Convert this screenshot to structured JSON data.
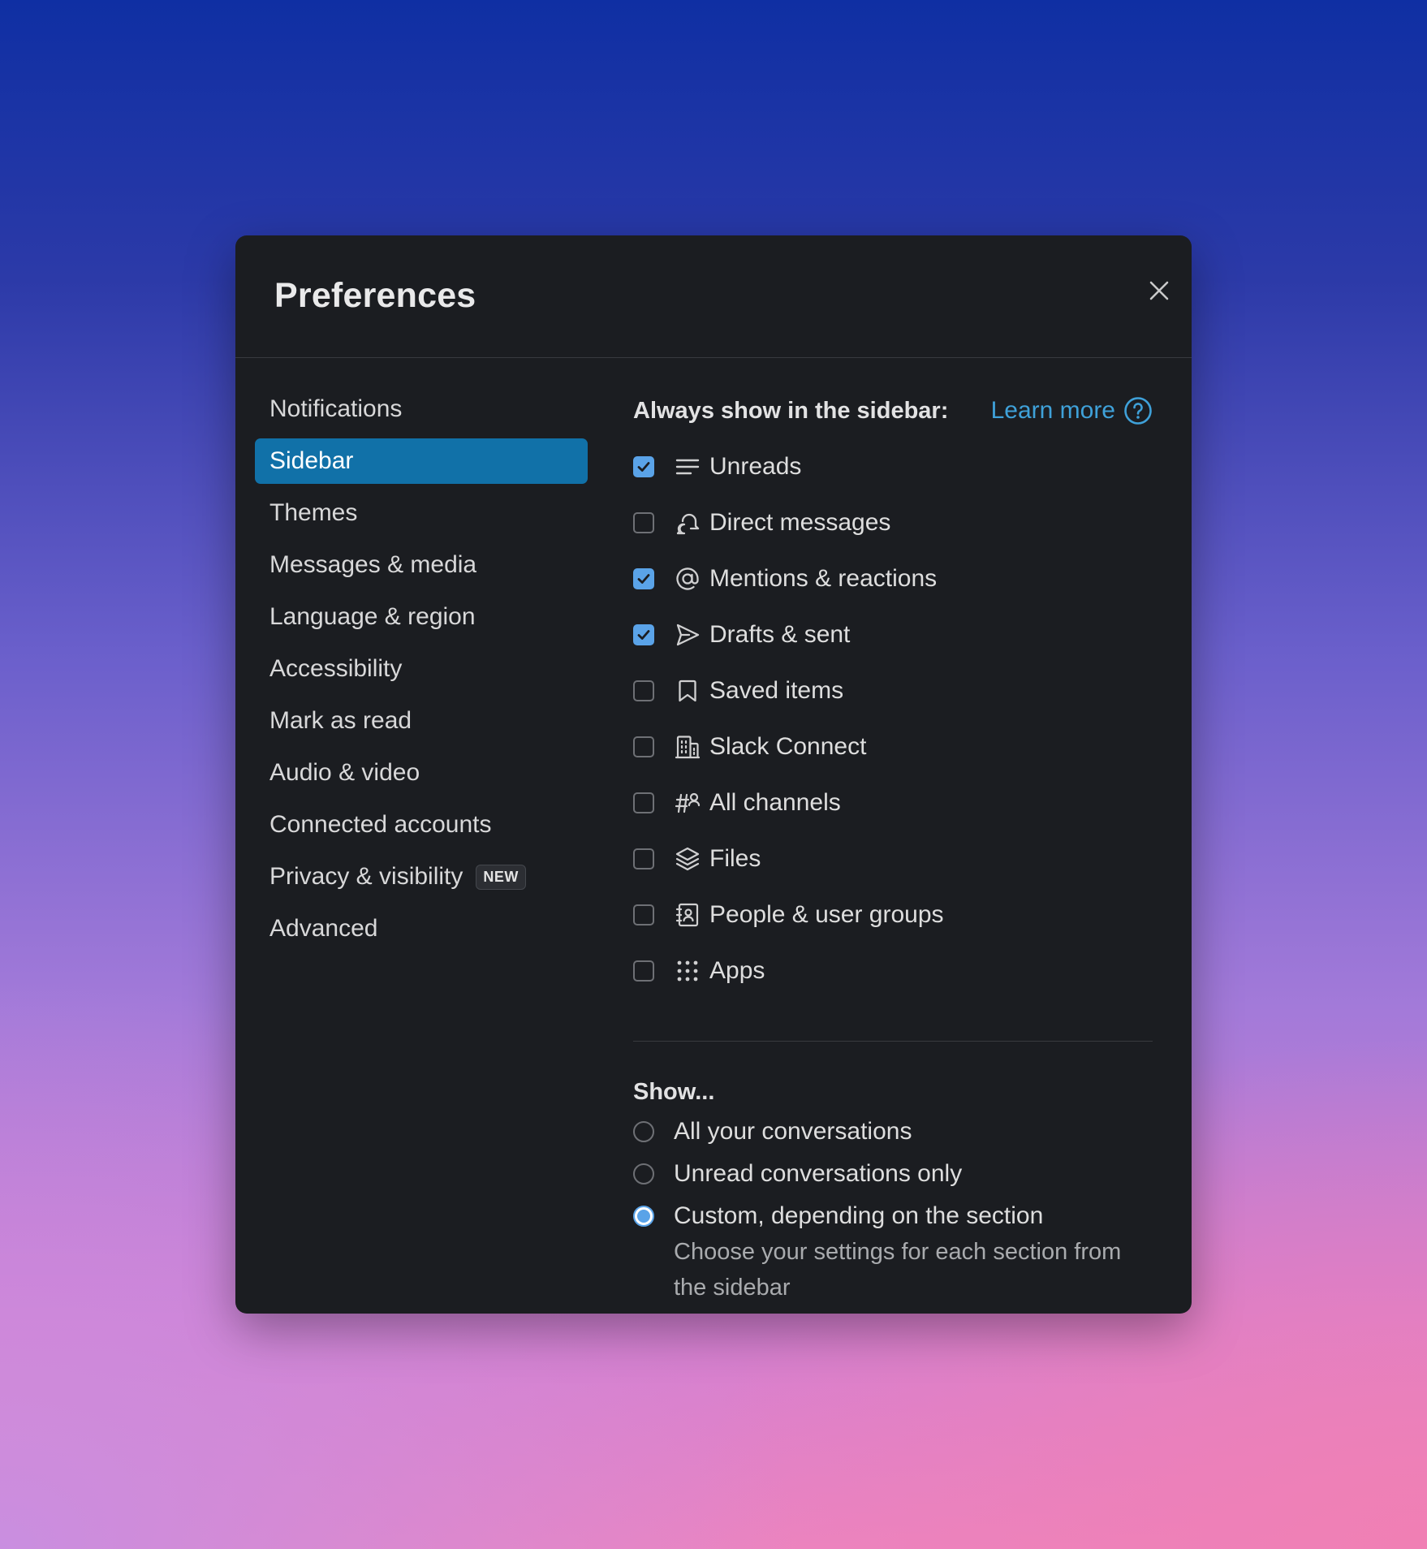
{
  "modal": {
    "title": "Preferences"
  },
  "nav": {
    "items": [
      {
        "label": "Notifications",
        "active": false
      },
      {
        "label": "Sidebar",
        "active": true
      },
      {
        "label": "Themes",
        "active": false
      },
      {
        "label": "Messages & media",
        "active": false
      },
      {
        "label": "Language & region",
        "active": false
      },
      {
        "label": "Accessibility",
        "active": false
      },
      {
        "label": "Mark as read",
        "active": false
      },
      {
        "label": "Audio & video",
        "active": false
      },
      {
        "label": "Connected accounts",
        "active": false
      },
      {
        "label": "Privacy & visibility",
        "active": false,
        "badge": "NEW"
      },
      {
        "label": "Advanced",
        "active": false
      }
    ]
  },
  "sidebar_settings": {
    "always_show_title": "Always show in the sidebar:",
    "learn_more": "Learn more",
    "items": [
      {
        "label": "Unreads",
        "checked": true,
        "icon": "unreads-icon"
      },
      {
        "label": "Direct messages",
        "checked": false,
        "icon": "direct-messages-icon"
      },
      {
        "label": "Mentions & reactions",
        "checked": true,
        "icon": "at-sign-icon"
      },
      {
        "label": "Drafts & sent",
        "checked": true,
        "icon": "send-icon"
      },
      {
        "label": "Saved items",
        "checked": false,
        "icon": "bookmark-icon"
      },
      {
        "label": "Slack Connect",
        "checked": false,
        "icon": "building-icon"
      },
      {
        "label": "All channels",
        "checked": false,
        "icon": "channels-icon"
      },
      {
        "label": "Files",
        "checked": false,
        "icon": "layers-icon"
      },
      {
        "label": "People & user groups",
        "checked": false,
        "icon": "contacts-icon"
      },
      {
        "label": "Apps",
        "checked": false,
        "icon": "apps-grid-icon"
      }
    ],
    "show_title": "Show...",
    "show_options": [
      {
        "label": "All your conversations",
        "selected": false
      },
      {
        "label": "Unread conversations only",
        "selected": false
      },
      {
        "label": "Custom, depending on the section",
        "selected": true,
        "description": "Choose your settings for each section from the sidebar"
      }
    ]
  },
  "colors": {
    "modal_background": "#1b1d21",
    "active_nav": "#1171a8",
    "checkbox_checked": "#5aa3e8",
    "link": "#3fa1d9"
  }
}
